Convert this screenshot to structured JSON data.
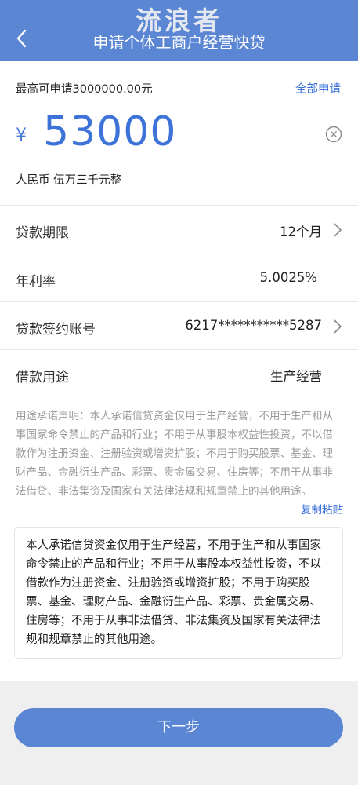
{
  "header": {
    "watermark": "流浪者",
    "title": "申请个体工商户经营快贷",
    "back_icon": "chevron-left-icon"
  },
  "amount_section": {
    "max_text": "最高可申请3000000.00元",
    "apply_all": "全部申请",
    "currency_symbol": "¥",
    "amount": "53000",
    "amount_in_words": "人民币 伍万三千元整",
    "clear_icon": "clear-circle-icon"
  },
  "rows": [
    {
      "label": "贷款期限",
      "value": "12个月",
      "has_chevron": true
    },
    {
      "label": "年利率",
      "value": "5.0025%",
      "has_chevron": false
    },
    {
      "label": "贷款签约账号",
      "value": "6217***********5287",
      "has_chevron": true
    },
    {
      "label": "借款用途",
      "value": "生产经营",
      "has_chevron": false
    }
  ],
  "declaration": {
    "text": "用途承诺声明：本人承诺信贷资金仅用于生产经营，不用于生产和从事国家命令禁止的产品和行业；不用于从事股本权益性投资，不以借款作为注册资金、注册验资或增资扩股；不用于购买股票、基金、理财产品、金融衍生产品、彩票、贵金属交易、住房等；不用于从事非法借贷、非法集资及国家有关法律法规和规章禁止的其他用途。",
    "copy_paste": "复制粘贴"
  },
  "textbox": {
    "value": "本人承诺信贷资金仅用于生产经营，不用于生产和从事国家命令禁止的产品和行业；不用于从事股本权益性投资，不以借款作为注册资金、注册验资或增资扩股；不用于购买股票、基金、理财产品、金融衍生产品、彩票、贵金属交易、住房等；不用于从事非法借贷、非法集资及国家有关法律法规和规章禁止的其他用途。"
  },
  "footer": {
    "next_button": "下一步"
  },
  "colors": {
    "header_bg": "#5b86d4",
    "accent": "#3d73d8",
    "button_bg": "#5b86d4"
  }
}
